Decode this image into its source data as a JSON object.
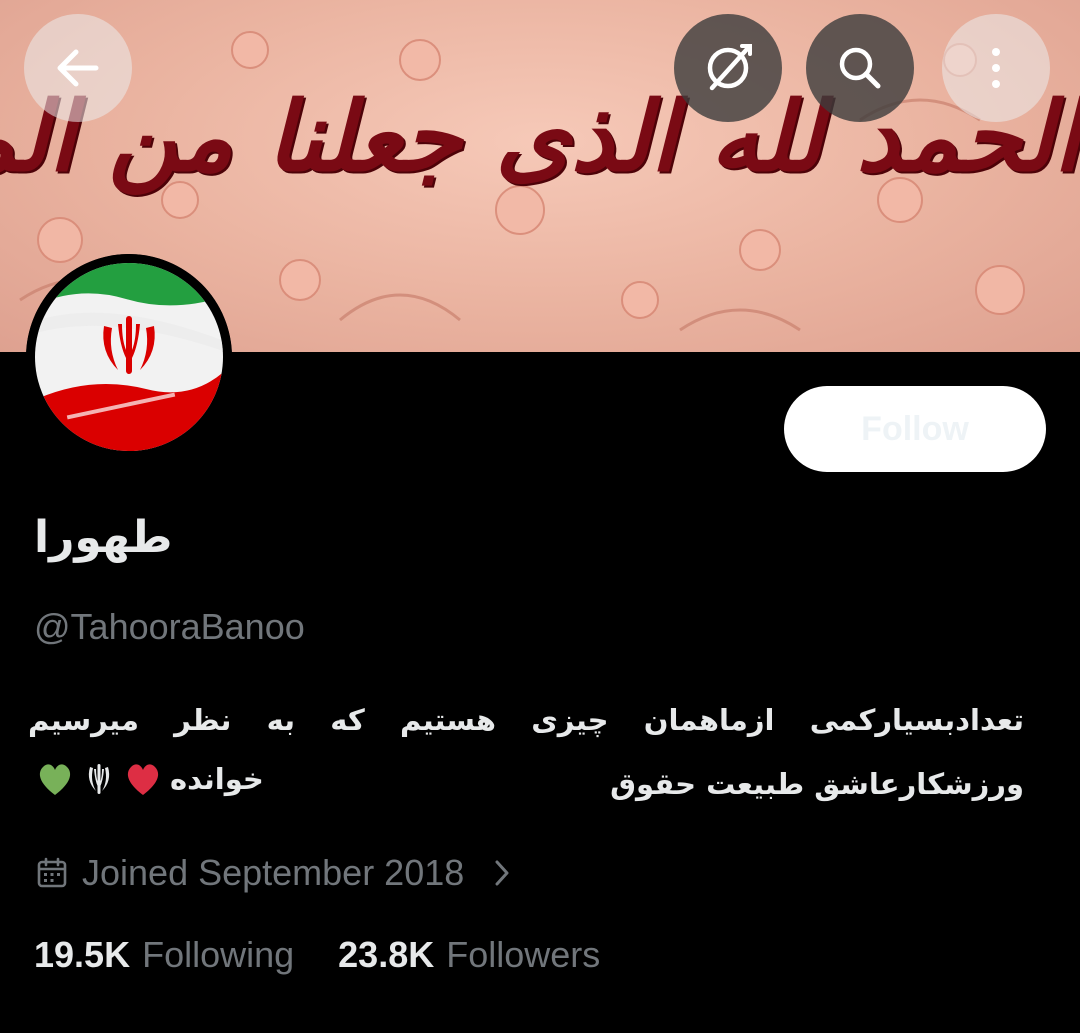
{
  "banner": {
    "calligraphy": "الحمد لله الذی جعلنا من المتمسکین بولایة امیرالمؤمنین",
    "bg_color": "#eab3a0",
    "text_color": "#7a0a14"
  },
  "toolbar": {
    "back_icon": "arrow-left-icon",
    "unfollow_icon": "unfollow-icon",
    "search_icon": "search-icon",
    "more_icon": "more-vertical-icon"
  },
  "avatar": {
    "alt": "Iran flag"
  },
  "follow": {
    "label": "Follow"
  },
  "profile": {
    "display_name": "طهورا",
    "handle": "@TahooraBanoo",
    "bio_line1": "تعدادبسیارکمی ازماهمان چیزی هستیم که به نظر میرسیم ورزشکارعاشق طبیعت حقوق",
    "bio_line2": "خوانده"
  },
  "joined": {
    "text": "Joined September 2018"
  },
  "stats": {
    "following_count": "19.5K",
    "following_label": "Following",
    "followers_count": "23.8K",
    "followers_label": "Followers"
  },
  "colors": {
    "background": "#000000",
    "text_primary": "#e7e9ea",
    "text_secondary": "#71767b",
    "follow_button_bg": "#ffffff"
  }
}
